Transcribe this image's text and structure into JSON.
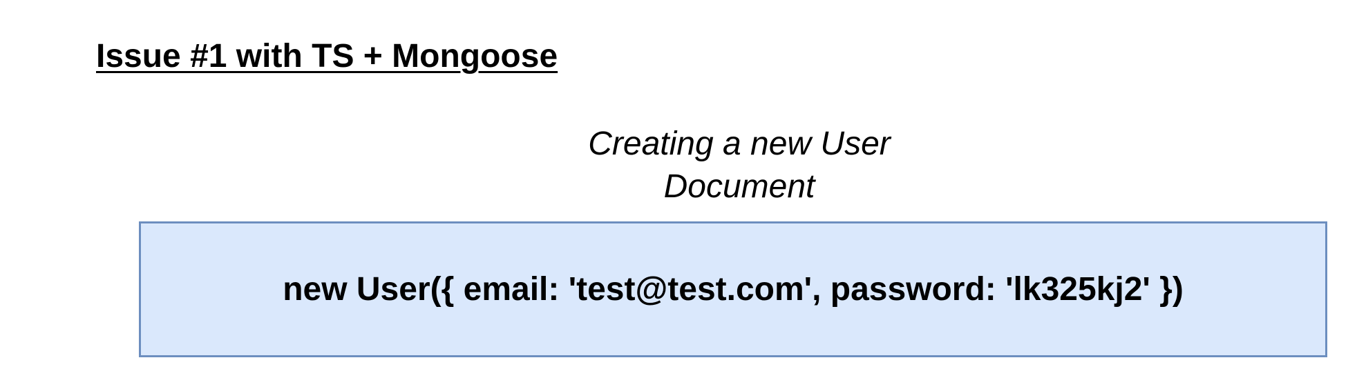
{
  "title": "Issue #1 with TS + Mongoose",
  "caption": {
    "line1": "Creating a new User",
    "line2": "Document"
  },
  "code_box": {
    "text": "new User({ email: 'test@test.com', password: 'lk325kj2' })",
    "fill_color": "#dae8fc",
    "stroke_color": "#6c8ebf"
  }
}
